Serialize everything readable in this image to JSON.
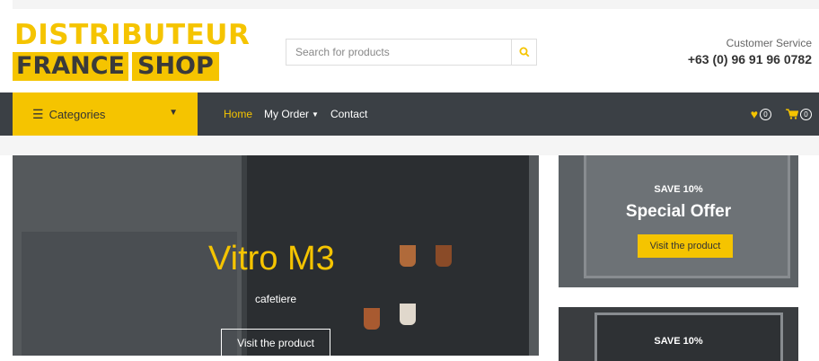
{
  "logo": {
    "line1": "DISTRIBUTEUR",
    "france": "FRANCE",
    "shop": "SHOP"
  },
  "search": {
    "placeholder": "Search for products",
    "icon": "search-icon"
  },
  "customer_service": {
    "label": "Customer Service",
    "phone": "+63 (0) 96 91 96 0782"
  },
  "categories": {
    "label": "Categories"
  },
  "nav": {
    "home": "Home",
    "my_order": "My Order",
    "contact": "Contact"
  },
  "wishlist": {
    "count": "0"
  },
  "cart": {
    "count": "0"
  },
  "hero": {
    "title": "Vitro M3",
    "subtitle": "cafetiere",
    "button": "Visit the product"
  },
  "promo1": {
    "save": "SAVE 10%",
    "title": "Special Offer",
    "button": "Visit the product"
  },
  "promo2": {
    "save": "SAVE 10%"
  },
  "colors": {
    "accent": "#f5c400",
    "nav_bg": "#3b4045"
  }
}
